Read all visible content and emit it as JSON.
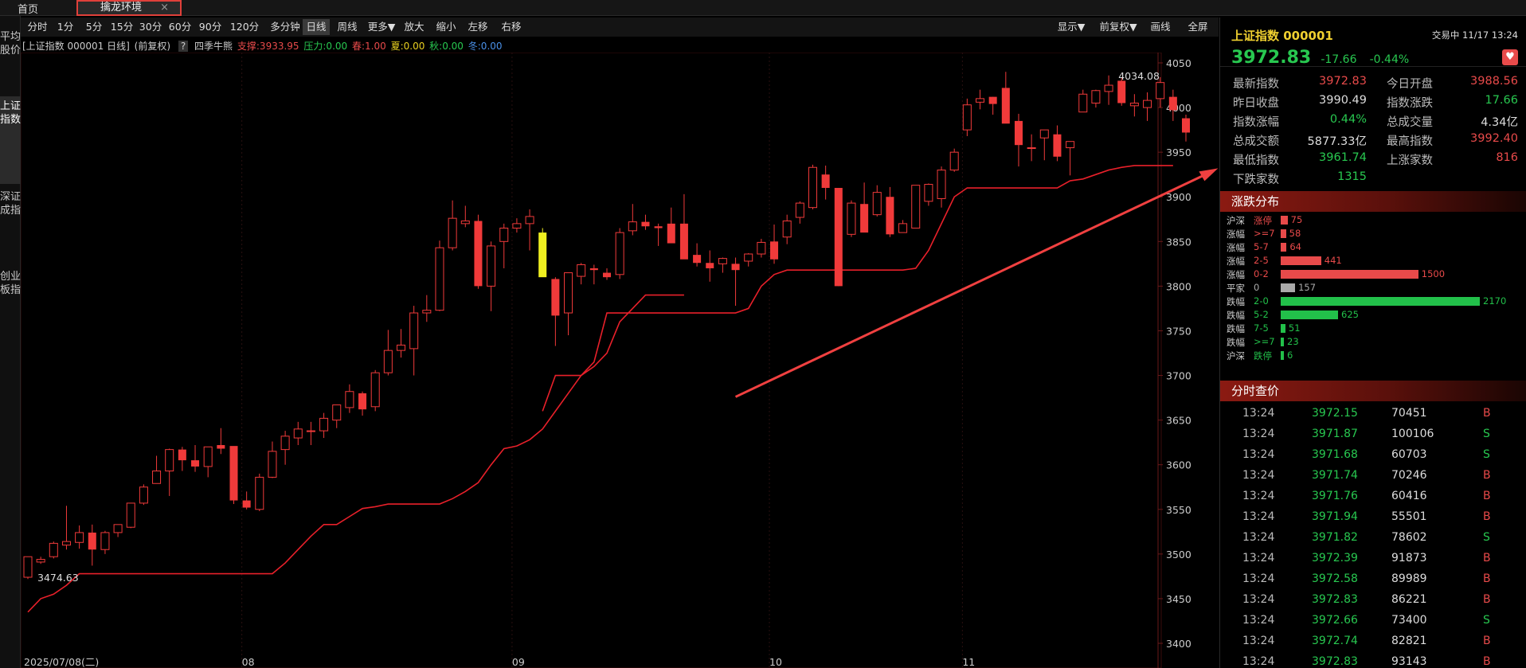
{
  "topbar": {
    "home": "首页",
    "tab_label": "擒龙环境",
    "tab_close": "×"
  },
  "sidebar": [
    {
      "label": "平均股价",
      "active": false
    },
    {
      "label": "上证指数",
      "active": true
    },
    {
      "label": "深证成指",
      "active": false
    },
    {
      "label": "创业板指",
      "active": false
    }
  ],
  "toolbar": {
    "left": [
      "分时",
      "1分",
      "5分",
      "15分",
      "30分",
      "60分",
      "90分",
      "120分",
      "多分钟",
      "日线",
      "周线",
      "更多▼",
      "放大",
      "缩小",
      "左移",
      "右移"
    ],
    "selected": "日线",
    "right": [
      "显示▼",
      "前复权▼",
      "画线",
      "全屏"
    ]
  },
  "infoline": {
    "title": "[上证指数 000001 日线]",
    "adj": "(前复权)",
    "help": "?",
    "indicator": "四季牛熊",
    "support": "支撑:3933.95",
    "pressure": "压力:0.00",
    "spring": "春:1.00",
    "summer": "夏:0.00",
    "autumn": "秋:0.00",
    "winter": "冬:0.00"
  },
  "quote": {
    "name": "上证指数 000001",
    "status": "交易中 11/17 13:24",
    "price": "3972.83",
    "change": "-17.66",
    "pct": "-0.44%",
    "rows": [
      [
        {
          "k": "最新指数",
          "v": "3972.83",
          "c": "#e84a4a"
        },
        {
          "k": "今日开盘",
          "v": "3988.56",
          "c": "#e84a4a"
        }
      ],
      [
        {
          "k": "昨日收盘",
          "v": "3990.49",
          "c": "#dddddd"
        },
        {
          "k": "指数涨跌",
          "v": "17.66",
          "c": "#28c850"
        }
      ],
      [
        {
          "k": "指数涨幅",
          "v": "0.44%",
          "c": "#28c850"
        },
        {
          "k": "总成交量",
          "v": "4.34亿",
          "c": "#dddddd"
        }
      ],
      [
        {
          "k": "总成交额",
          "v": "5877.33亿",
          "c": "#dddddd"
        },
        {
          "k": "最高指数",
          "v": "3992.40",
          "c": "#e84a4a"
        }
      ],
      [
        {
          "k": "最低指数",
          "v": "3961.74",
          "c": "#28c850"
        },
        {
          "k": "上涨家数",
          "v": "816",
          "c": "#e84a4a"
        }
      ],
      [
        {
          "k": "下跌家数",
          "v": "1315",
          "c": "#28c850"
        }
      ]
    ]
  },
  "distribution": {
    "title": "涨跌分布",
    "rows": [
      {
        "a": "沪深",
        "b": "涨停",
        "n": 75,
        "color": "#e84a4a"
      },
      {
        "a": "涨幅",
        "b": ">=7",
        "n": 58,
        "color": "#e84a4a"
      },
      {
        "a": "涨幅",
        "b": "5-7",
        "n": 64,
        "color": "#e84a4a"
      },
      {
        "a": "涨幅",
        "b": "2-5",
        "n": 441,
        "color": "#e84a4a"
      },
      {
        "a": "涨幅",
        "b": "0-2",
        "n": 1500,
        "color": "#e84a4a"
      },
      {
        "a": "平家",
        "b": "0",
        "n": 157,
        "color": "#aaaaaa"
      },
      {
        "a": "跌幅",
        "b": "2-0",
        "n": 2170,
        "color": "#22c04a"
      },
      {
        "a": "跌幅",
        "b": "5-2",
        "n": 625,
        "color": "#22c04a"
      },
      {
        "a": "跌幅",
        "b": "7-5",
        "n": 51,
        "color": "#22c04a"
      },
      {
        "a": "跌幅",
        "b": ">=7",
        "n": 23,
        "color": "#22c04a"
      },
      {
        "a": "沪深",
        "b": "跌停",
        "n": 6,
        "color": "#22c04a"
      }
    ]
  },
  "ticks": {
    "title": "分时查价",
    "rows": [
      [
        "13:24",
        "3972.15",
        "70451",
        "B"
      ],
      [
        "13:24",
        "3971.87",
        "100106",
        "S"
      ],
      [
        "13:24",
        "3971.68",
        "60703",
        "S"
      ],
      [
        "13:24",
        "3971.74",
        "70246",
        "B"
      ],
      [
        "13:24",
        "3971.76",
        "60416",
        "B"
      ],
      [
        "13:24",
        "3971.94",
        "55501",
        "B"
      ],
      [
        "13:24",
        "3971.82",
        "78602",
        "S"
      ],
      [
        "13:24",
        "3972.39",
        "91873",
        "B"
      ],
      [
        "13:24",
        "3972.58",
        "89989",
        "B"
      ],
      [
        "13:24",
        "3972.83",
        "86221",
        "B"
      ],
      [
        "13:24",
        "3972.66",
        "73400",
        "S"
      ],
      [
        "13:24",
        "3972.74",
        "82821",
        "B"
      ],
      [
        "13:24",
        "3972.83",
        "93143",
        "B"
      ]
    ]
  },
  "chart_data": {
    "type": "candlestick",
    "y_ticks": [
      4050,
      4000,
      3950,
      3900,
      3850,
      3800,
      3750,
      3700,
      3650,
      3600,
      3550,
      3500,
      3450,
      3400
    ],
    "ylim": [
      3400,
      4050
    ],
    "x_labels": [
      "2025/07/08(二)",
      "08",
      "09",
      "10",
      "11"
    ],
    "x_label_index": [
      0,
      17,
      38,
      58,
      73
    ],
    "high_label": "4034.08",
    "low_label": "3474.63",
    "candles": [
      [
        3474,
        3497,
        3472,
        3497
      ],
      [
        3491,
        3497,
        3489,
        3494
      ],
      [
        3497,
        3514,
        3495,
        3512
      ],
      [
        3510,
        3554,
        3505,
        3514
      ],
      [
        3513,
        3532,
        3506,
        3524
      ],
      [
        3524,
        3533,
        3487,
        3505
      ],
      [
        3505,
        3526,
        3500,
        3524
      ],
      [
        3524,
        3532,
        3519,
        3533
      ],
      [
        3530,
        3547,
        3529,
        3557
      ],
      [
        3557,
        3578,
        3555,
        3575
      ],
      [
        3579,
        3610,
        3582,
        3593
      ],
      [
        3593,
        3618,
        3565,
        3617
      ],
      [
        3617,
        3620,
        3593,
        3605
      ],
      [
        3605,
        3622,
        3592,
        3598
      ],
      [
        3598,
        3618,
        3586,
        3620
      ],
      [
        3622,
        3641,
        3612,
        3618
      ],
      [
        3621,
        3582,
        3556,
        3560
      ],
      [
        3560,
        3570,
        3550,
        3552
      ],
      [
        3550,
        3590,
        3548,
        3586
      ],
      [
        3586,
        3626,
        3585,
        3615
      ],
      [
        3617,
        3638,
        3600,
        3632
      ],
      [
        3630,
        3648,
        3622,
        3640
      ],
      [
        3638,
        3648,
        3622,
        3638
      ],
      [
        3638,
        3658,
        3630,
        3652
      ],
      [
        3650,
        3667,
        3641,
        3667
      ],
      [
        3664,
        3690,
        3658,
        3682
      ],
      [
        3680,
        3682,
        3655,
        3662
      ],
      [
        3665,
        3706,
        3660,
        3703
      ],
      [
        3703,
        3751,
        3700,
        3728
      ],
      [
        3728,
        3752,
        3720,
        3734
      ],
      [
        3730,
        3778,
        3700,
        3770
      ],
      [
        3770,
        3790,
        3760,
        3773
      ],
      [
        3773,
        3851,
        3772,
        3843
      ],
      [
        3843,
        3896,
        3840,
        3876
      ],
      [
        3870,
        3890,
        3866,
        3873
      ],
      [
        3873,
        3880,
        3797,
        3800
      ],
      [
        3800,
        3850,
        3772,
        3845
      ],
      [
        3850,
        3870,
        3820,
        3865
      ],
      [
        3865,
        3876,
        3860,
        3870
      ],
      [
        3870,
        3886,
        3840,
        3878
      ],
      [
        3860,
        3865,
        3813,
        3810
      ],
      [
        3808,
        3810,
        3733,
        3767
      ],
      [
        3770,
        3812,
        3745,
        3815
      ],
      [
        3811,
        3826,
        3802,
        3824
      ],
      [
        3820,
        3824,
        3802,
        3818
      ],
      [
        3815,
        3820,
        3807,
        3810
      ],
      [
        3813,
        3865,
        3808,
        3860
      ],
      [
        3862,
        3892,
        3857,
        3872
      ],
      [
        3872,
        3880,
        3863,
        3867
      ],
      [
        3867,
        3870,
        3845,
        3865
      ],
      [
        3870,
        3888,
        3850,
        3848
      ],
      [
        3870,
        3903,
        3842,
        3830
      ],
      [
        3835,
        3848,
        3822,
        3826
      ],
      [
        3826,
        3840,
        3805,
        3820
      ],
      [
        3825,
        3832,
        3815,
        3831
      ],
      [
        3825,
        3832,
        3778,
        3818
      ],
      [
        3828,
        3837,
        3822,
        3836
      ],
      [
        3836,
        3853,
        3832,
        3849
      ],
      [
        3850,
        3869,
        3825,
        3830
      ],
      [
        3855,
        3880,
        3847,
        3873
      ],
      [
        3877,
        3895,
        3870,
        3893
      ],
      [
        3888,
        3936,
        3886,
        3933
      ],
      [
        3925,
        3935,
        3897,
        3910
      ],
      [
        3910,
        3910,
        3800,
        3800
      ],
      [
        3858,
        3896,
        3855,
        3893
      ],
      [
        3892,
        3916,
        3862,
        3860
      ],
      [
        3880,
        3913,
        3878,
        3905
      ],
      [
        3900,
        3911,
        3855,
        3858
      ],
      [
        3860,
        3874,
        3860,
        3870
      ],
      [
        3865,
        3913,
        3870,
        3913
      ],
      [
        3895,
        3915,
        3890,
        3914
      ],
      [
        3898,
        3934,
        3888,
        3930
      ],
      [
        3930,
        3954,
        3928,
        3950
      ],
      [
        3975,
        4010,
        3968,
        4003
      ],
      [
        4006,
        4020,
        3998,
        4010
      ],
      [
        4012,
        4012,
        3992,
        4004
      ],
      [
        4022,
        4040,
        3998,
        3982
      ],
      [
        3985,
        3993,
        3934,
        3958
      ],
      [
        3955,
        3970,
        3940,
        3955
      ],
      [
        3966,
        3975,
        3941,
        3975
      ],
      [
        3970,
        3980,
        3940,
        3945
      ],
      [
        3955,
        3960,
        3924,
        3962
      ],
      [
        3995,
        4020,
        3995,
        4015
      ],
      [
        4005,
        4020,
        4000,
        4019
      ],
      [
        4018,
        4036,
        4003,
        4025
      ],
      [
        4030,
        4034,
        4002,
        4005
      ],
      [
        4002,
        4015,
        3990,
        4005
      ],
      [
        4000,
        4017,
        3985,
        4008
      ],
      [
        4010,
        4034,
        4000,
        4028
      ],
      [
        4012,
        4020,
        3985,
        3997
      ],
      [
        3988,
        3992,
        3962,
        3972
      ]
    ],
    "support_line": [
      3435,
      3450,
      3455,
      3465,
      3478,
      3478,
      3478,
      3478,
      3478,
      3478,
      3478,
      3478,
      3478,
      3478,
      3478,
      3478,
      3478,
      3478,
      3478,
      3478,
      3490,
      3505,
      3520,
      3533,
      3533,
      3542,
      3551,
      3553,
      3556,
      3556,
      3556,
      3556,
      3556,
      3562,
      3570,
      3580,
      3600,
      3618,
      3621,
      3628,
      3640,
      3660,
      3680,
      3700,
      3710,
      3725,
      3760,
      3775,
      3790,
      3790,
      3790,
      3790
    ],
    "support2": [
      3660,
      3700,
      3700,
      3700,
      3715,
      3770,
      3770,
      3770,
      3770,
      3770,
      3770,
      3770,
      3770,
      3770,
      3770,
      3770,
      3775,
      3800,
      3813,
      3818,
      3818,
      3818,
      3818,
      3818,
      3818,
      3818,
      3818,
      3818,
      3818,
      3820,
      3840,
      3870,
      3900,
      3910,
      3910,
      3910,
      3910,
      3910,
      3910,
      3910,
      3910,
      3918,
      3920,
      3925,
      3930,
      3933,
      3935,
      3935,
      3935,
      3935
    ],
    "arrow_label": ""
  }
}
